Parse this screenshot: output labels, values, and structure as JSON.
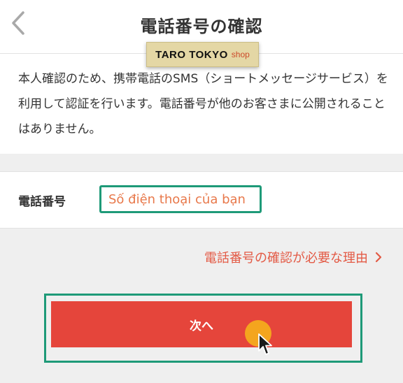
{
  "header": {
    "back_icon": "chevron-left-icon",
    "title": "電話番号の確認"
  },
  "watermark": {
    "main": "TARO TOKYO",
    "sub": "shop"
  },
  "intro": {
    "text": "本人確認のため、携帯電話のSMS（ショートメッセージサービス）を利用して認証を行います。電話番号が他のお客さまに公開されることはありません。"
  },
  "phone": {
    "label": "電話番号",
    "placeholder": "Số điện thoại của bạn",
    "value": ""
  },
  "reason_link": {
    "label": "電話番号の確認が必要な理由",
    "icon": "chevron-right-icon"
  },
  "next_button": {
    "label": "次へ"
  },
  "colors": {
    "accent_red": "#e5453b",
    "link_red": "#e35a45",
    "highlight_green": "#1e9a78",
    "cursor_dot": "#f4ab1c"
  }
}
